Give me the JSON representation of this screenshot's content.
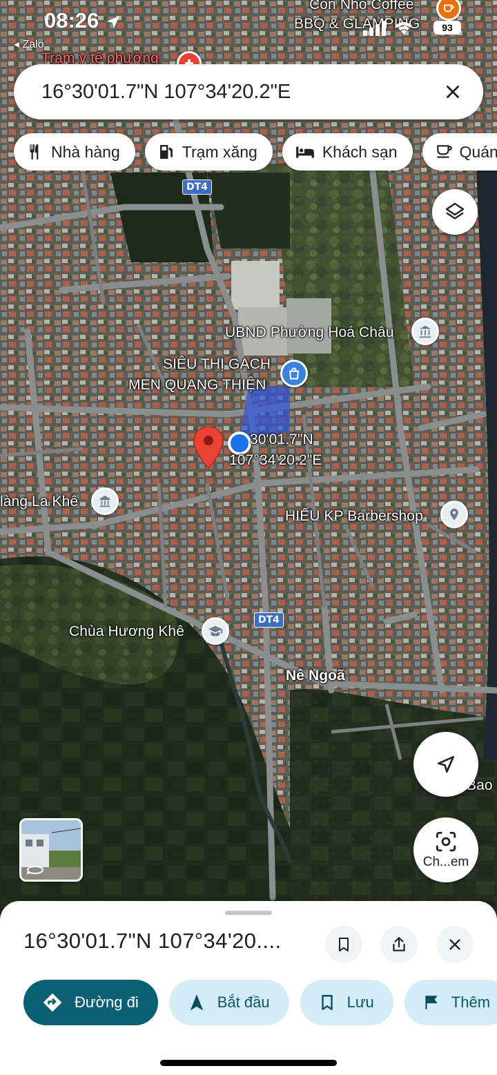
{
  "status_bar": {
    "time": "08:26",
    "back_app": "◂ Zalo",
    "battery": "93"
  },
  "search": {
    "query": "16°30'01.7\"N 107°34'20.2\"E"
  },
  "chips": [
    {
      "label": "Nhà hàng",
      "icon": "restaurant-icon"
    },
    {
      "label": "Trạm xăng",
      "icon": "gas-station-icon"
    },
    {
      "label": "Khách sạn",
      "icon": "hotel-icon"
    },
    {
      "label": "Quán",
      "icon": "cafe-icon"
    }
  ],
  "map": {
    "labels": {
      "top_poi_1": "Con Nhỏ Coffee",
      "top_poi_2": "BBQ & GLAMPING",
      "tram_y_te": "Trạm y tế phường",
      "ubnd": "UBND Phường Hoá Châu",
      "sieu_thi_1": "SIÊU THỊ GẠCH",
      "sieu_thi_2": "MEN QUANG THIỆN",
      "coord_1": "30'01.7\"N",
      "coord_2": "107°34'20.2\"E",
      "lang_la_khe": "làng La Khê",
      "barbershop": "HIẾU KP Barbershop",
      "chua": "Chùa Hương Khê",
      "ne_ngoa": "Nê Ngoã",
      "bao": "Bao",
      "road_dt4_top": "DT4",
      "road_dt4_mid": "DT4"
    }
  },
  "controls": {
    "camera_label": "Ch...em"
  },
  "sheet": {
    "title": "16°30'01.7\"N 107°34'20....",
    "actions": [
      {
        "label": "Đường đi",
        "icon": "directions-icon"
      },
      {
        "label": "Bắt đầu",
        "icon": "navigation-arrow-icon"
      },
      {
        "label": "Lưu",
        "icon": "bookmark-icon"
      },
      {
        "label": "Thêm",
        "icon": "flag-icon"
      }
    ]
  },
  "colors": {
    "primary_action": "#0b5f72",
    "secondary_action": "#d3ecf6",
    "pin": "#ea4335",
    "location_dot": "#1a73e8"
  }
}
